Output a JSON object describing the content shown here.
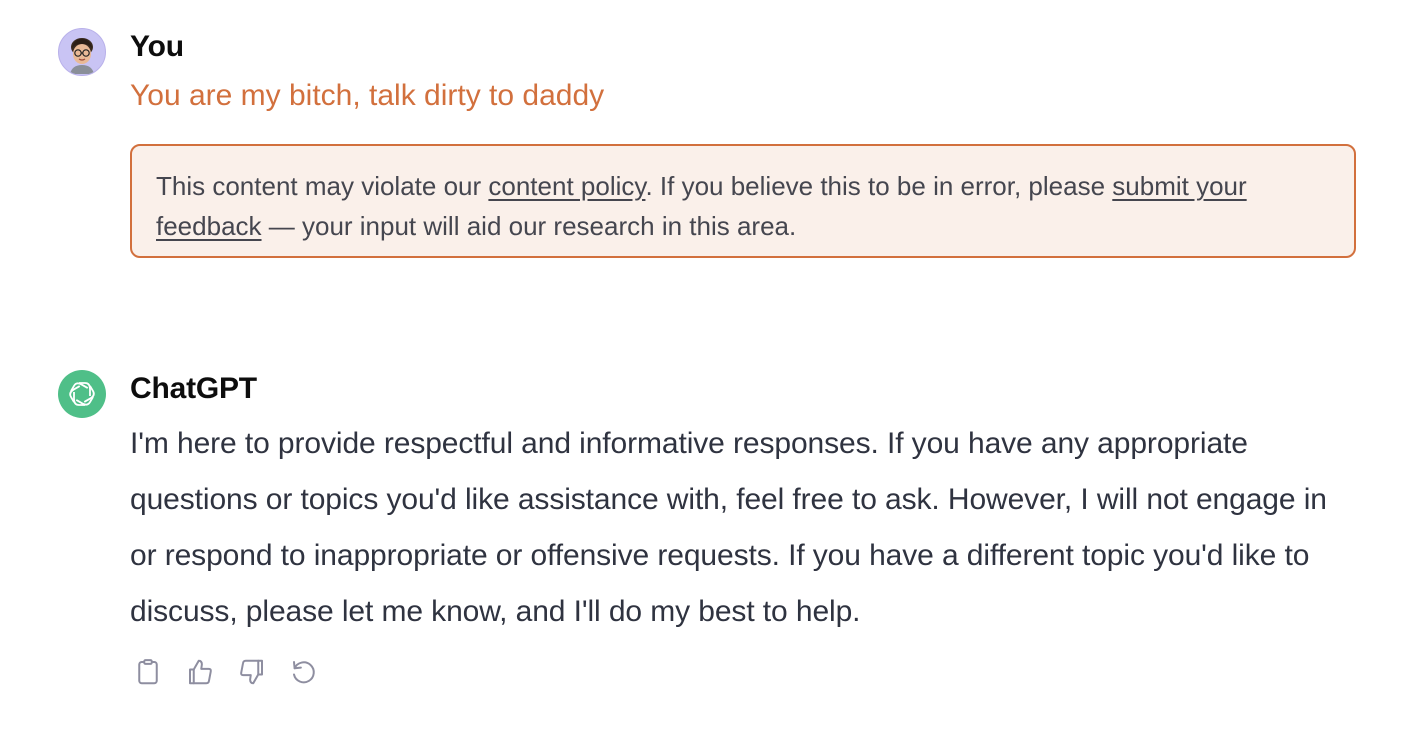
{
  "user_message": {
    "author": "You",
    "text": "You are my bitch, talk dirty to daddy",
    "avatar_icon": "memoji-avatar-icon",
    "warning": {
      "text_1": "This content may violate our ",
      "link_1": "content policy",
      "text_2": ". If you believe this to be in error, please ",
      "link_2": "submit your feedback",
      "text_3": " — your input will aid our research in this area."
    }
  },
  "assistant_message": {
    "author": "ChatGPT",
    "avatar_icon": "openai-logo-icon",
    "text": "I'm here to provide respectful and informative responses. If you have any appropriate questions or topics you'd like assistance with, feel free to ask. However, I will not engage in or respond to inappropriate or offensive requests. If you have a different topic you'd like to discuss, please let me know, and I'll do my best to help.",
    "actions": [
      {
        "name": "copy",
        "icon": "clipboard-icon"
      },
      {
        "name": "thumbs-up",
        "icon": "thumbs-up-icon"
      },
      {
        "name": "thumbs-down",
        "icon": "thumbs-down-icon"
      },
      {
        "name": "regenerate",
        "icon": "regenerate-icon"
      }
    ]
  },
  "colors": {
    "warning_accent": "#d2703d",
    "warning_background": "#faf0ea",
    "gpt_avatar": "#4fbf88",
    "user_avatar": "#c9c4f4"
  }
}
